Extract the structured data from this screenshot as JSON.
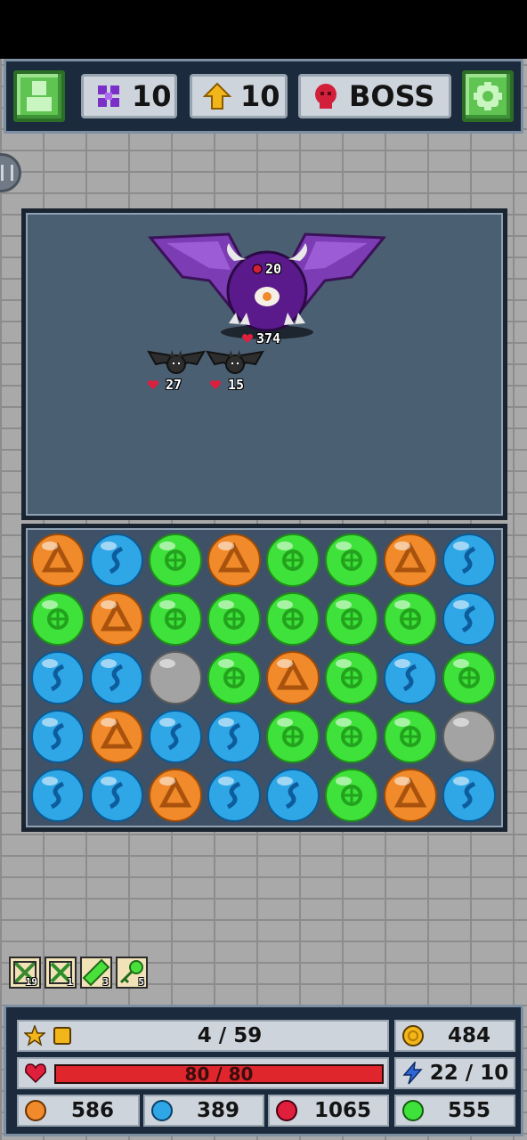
{
  "topbar": {
    "gems": "10",
    "level": "10",
    "boss_label": "BOSS"
  },
  "battle": {
    "boss": {
      "armor": "20",
      "hp": "374"
    },
    "minions": [
      {
        "hp": "27"
      },
      {
        "hp": "15"
      }
    ]
  },
  "board": {
    "rows": [
      [
        "orange",
        "blue",
        "green",
        "orange",
        "green",
        "green",
        "orange",
        "blue"
      ],
      [
        "green",
        "orange",
        "green",
        "green",
        "green",
        "green",
        "green",
        "blue"
      ],
      [
        "blue",
        "blue",
        "gray",
        "green",
        "orange",
        "green",
        "blue",
        "green"
      ],
      [
        "blue",
        "orange",
        "blue",
        "blue",
        "green",
        "green",
        "green",
        "gray"
      ],
      [
        "blue",
        "blue",
        "orange",
        "blue",
        "blue",
        "green",
        "orange",
        "blue"
      ]
    ],
    "colors": {
      "orange": "#f08a2a",
      "blue": "#2fa6e6",
      "green": "#3fe23a",
      "gray": "#a3a3a3"
    }
  },
  "powerups": [
    {
      "icon": "bomb-grid-icon",
      "count": "19"
    },
    {
      "icon": "x-grid-icon",
      "count": "1"
    },
    {
      "icon": "green-slash-icon",
      "count": "3"
    },
    {
      "icon": "green-key-icon",
      "count": "5"
    }
  ],
  "stats": {
    "xp": "4 / 59",
    "coins": "484",
    "hp_text": "80 / 80",
    "hp_fraction": 1.0,
    "mana": "22 / 10",
    "orange_total": "586",
    "blue_total": "389",
    "red_total": "1065",
    "green_total": "555"
  }
}
